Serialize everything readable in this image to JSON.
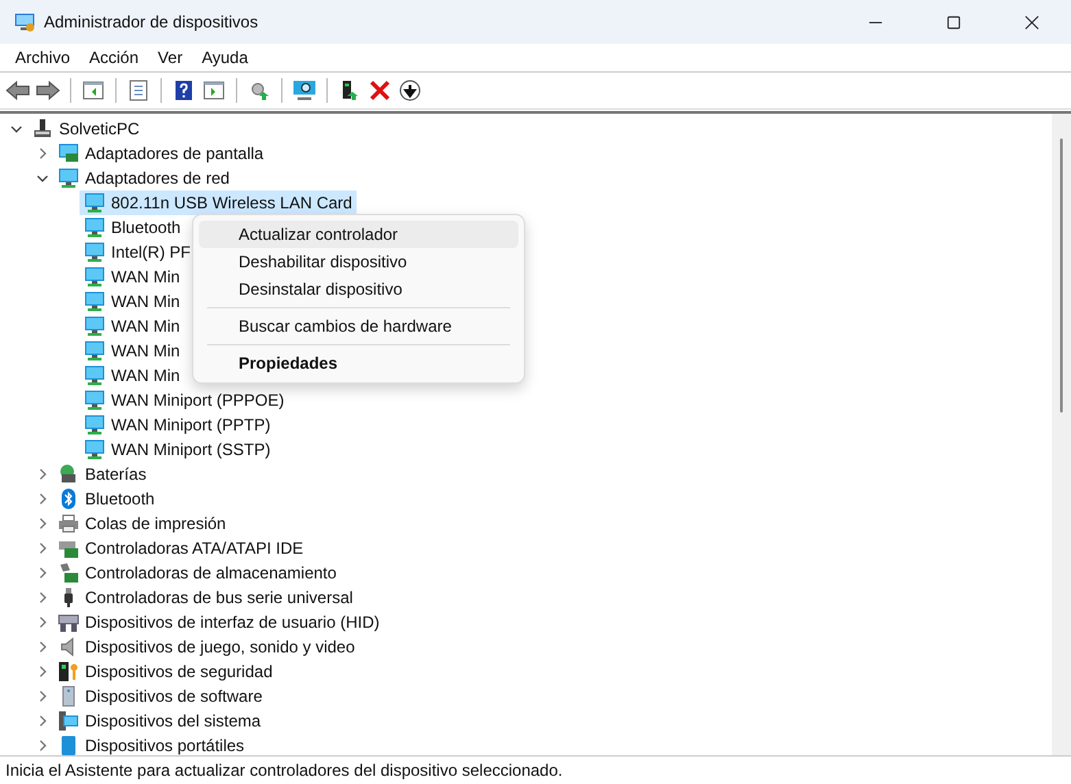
{
  "window": {
    "title": "Administrador de dispositivos"
  },
  "menu_bar": [
    "Archivo",
    "Acción",
    "Ver",
    "Ayuda"
  ],
  "tree": {
    "label": "SolveticPC",
    "expanded": true,
    "children": [
      {
        "label": "Adaptadores de pantalla",
        "expanded": false
      },
      {
        "label": "Adaptadores de red",
        "expanded": true,
        "children": [
          {
            "label": "802.11n USB Wireless LAN Card",
            "selected": true
          },
          {
            "label": "Bluetooth",
            "selected": false
          },
          {
            "label": "Intel(R) PF",
            "selected": false
          },
          {
            "label": "WAN Min",
            "selected": false
          },
          {
            "label": "WAN Min",
            "selected": false
          },
          {
            "label": "WAN Min",
            "selected": false
          },
          {
            "label": "WAN Min",
            "selected": false
          },
          {
            "label": "WAN Min",
            "selected": false
          },
          {
            "label": "WAN Miniport (PPPOE)",
            "selected": false
          },
          {
            "label": "WAN Miniport (PPTP)",
            "selected": false
          },
          {
            "label": "WAN Miniport (SSTP)",
            "selected": false
          }
        ]
      },
      {
        "label": "Baterías",
        "expanded": false
      },
      {
        "label": "Bluetooth",
        "expanded": false
      },
      {
        "label": "Colas de impresión",
        "expanded": false
      },
      {
        "label": "Controladoras ATA/ATAPI IDE",
        "expanded": false
      },
      {
        "label": "Controladoras de almacenamiento",
        "expanded": false
      },
      {
        "label": "Controladoras de bus serie universal",
        "expanded": false
      },
      {
        "label": "Dispositivos de interfaz de usuario (HID)",
        "expanded": false
      },
      {
        "label": "Dispositivos de juego, sonido y video",
        "expanded": false
      },
      {
        "label": "Dispositivos de seguridad",
        "expanded": false
      },
      {
        "label": "Dispositivos de software",
        "expanded": false
      },
      {
        "label": "Dispositivos del sistema",
        "expanded": false
      },
      {
        "label": "Dispositivos portátiles",
        "expanded": false
      }
    ]
  },
  "context_menu": [
    {
      "kind": "item",
      "label": "Actualizar controlador",
      "selected": true,
      "default": false
    },
    {
      "kind": "item",
      "label": "Deshabilitar dispositivo",
      "selected": false,
      "default": false
    },
    {
      "kind": "item",
      "label": "Desinstalar dispositivo",
      "selected": false,
      "default": false
    },
    {
      "kind": "separator"
    },
    {
      "kind": "item",
      "label": "Buscar cambios de hardware",
      "selected": false,
      "default": false
    },
    {
      "kind": "separator"
    },
    {
      "kind": "item",
      "label": "Propiedades",
      "selected": false,
      "default": true
    }
  ],
  "status_bar": {
    "text": "Inicia el Asistente para actualizar controladores del dispositivo seleccionado."
  }
}
